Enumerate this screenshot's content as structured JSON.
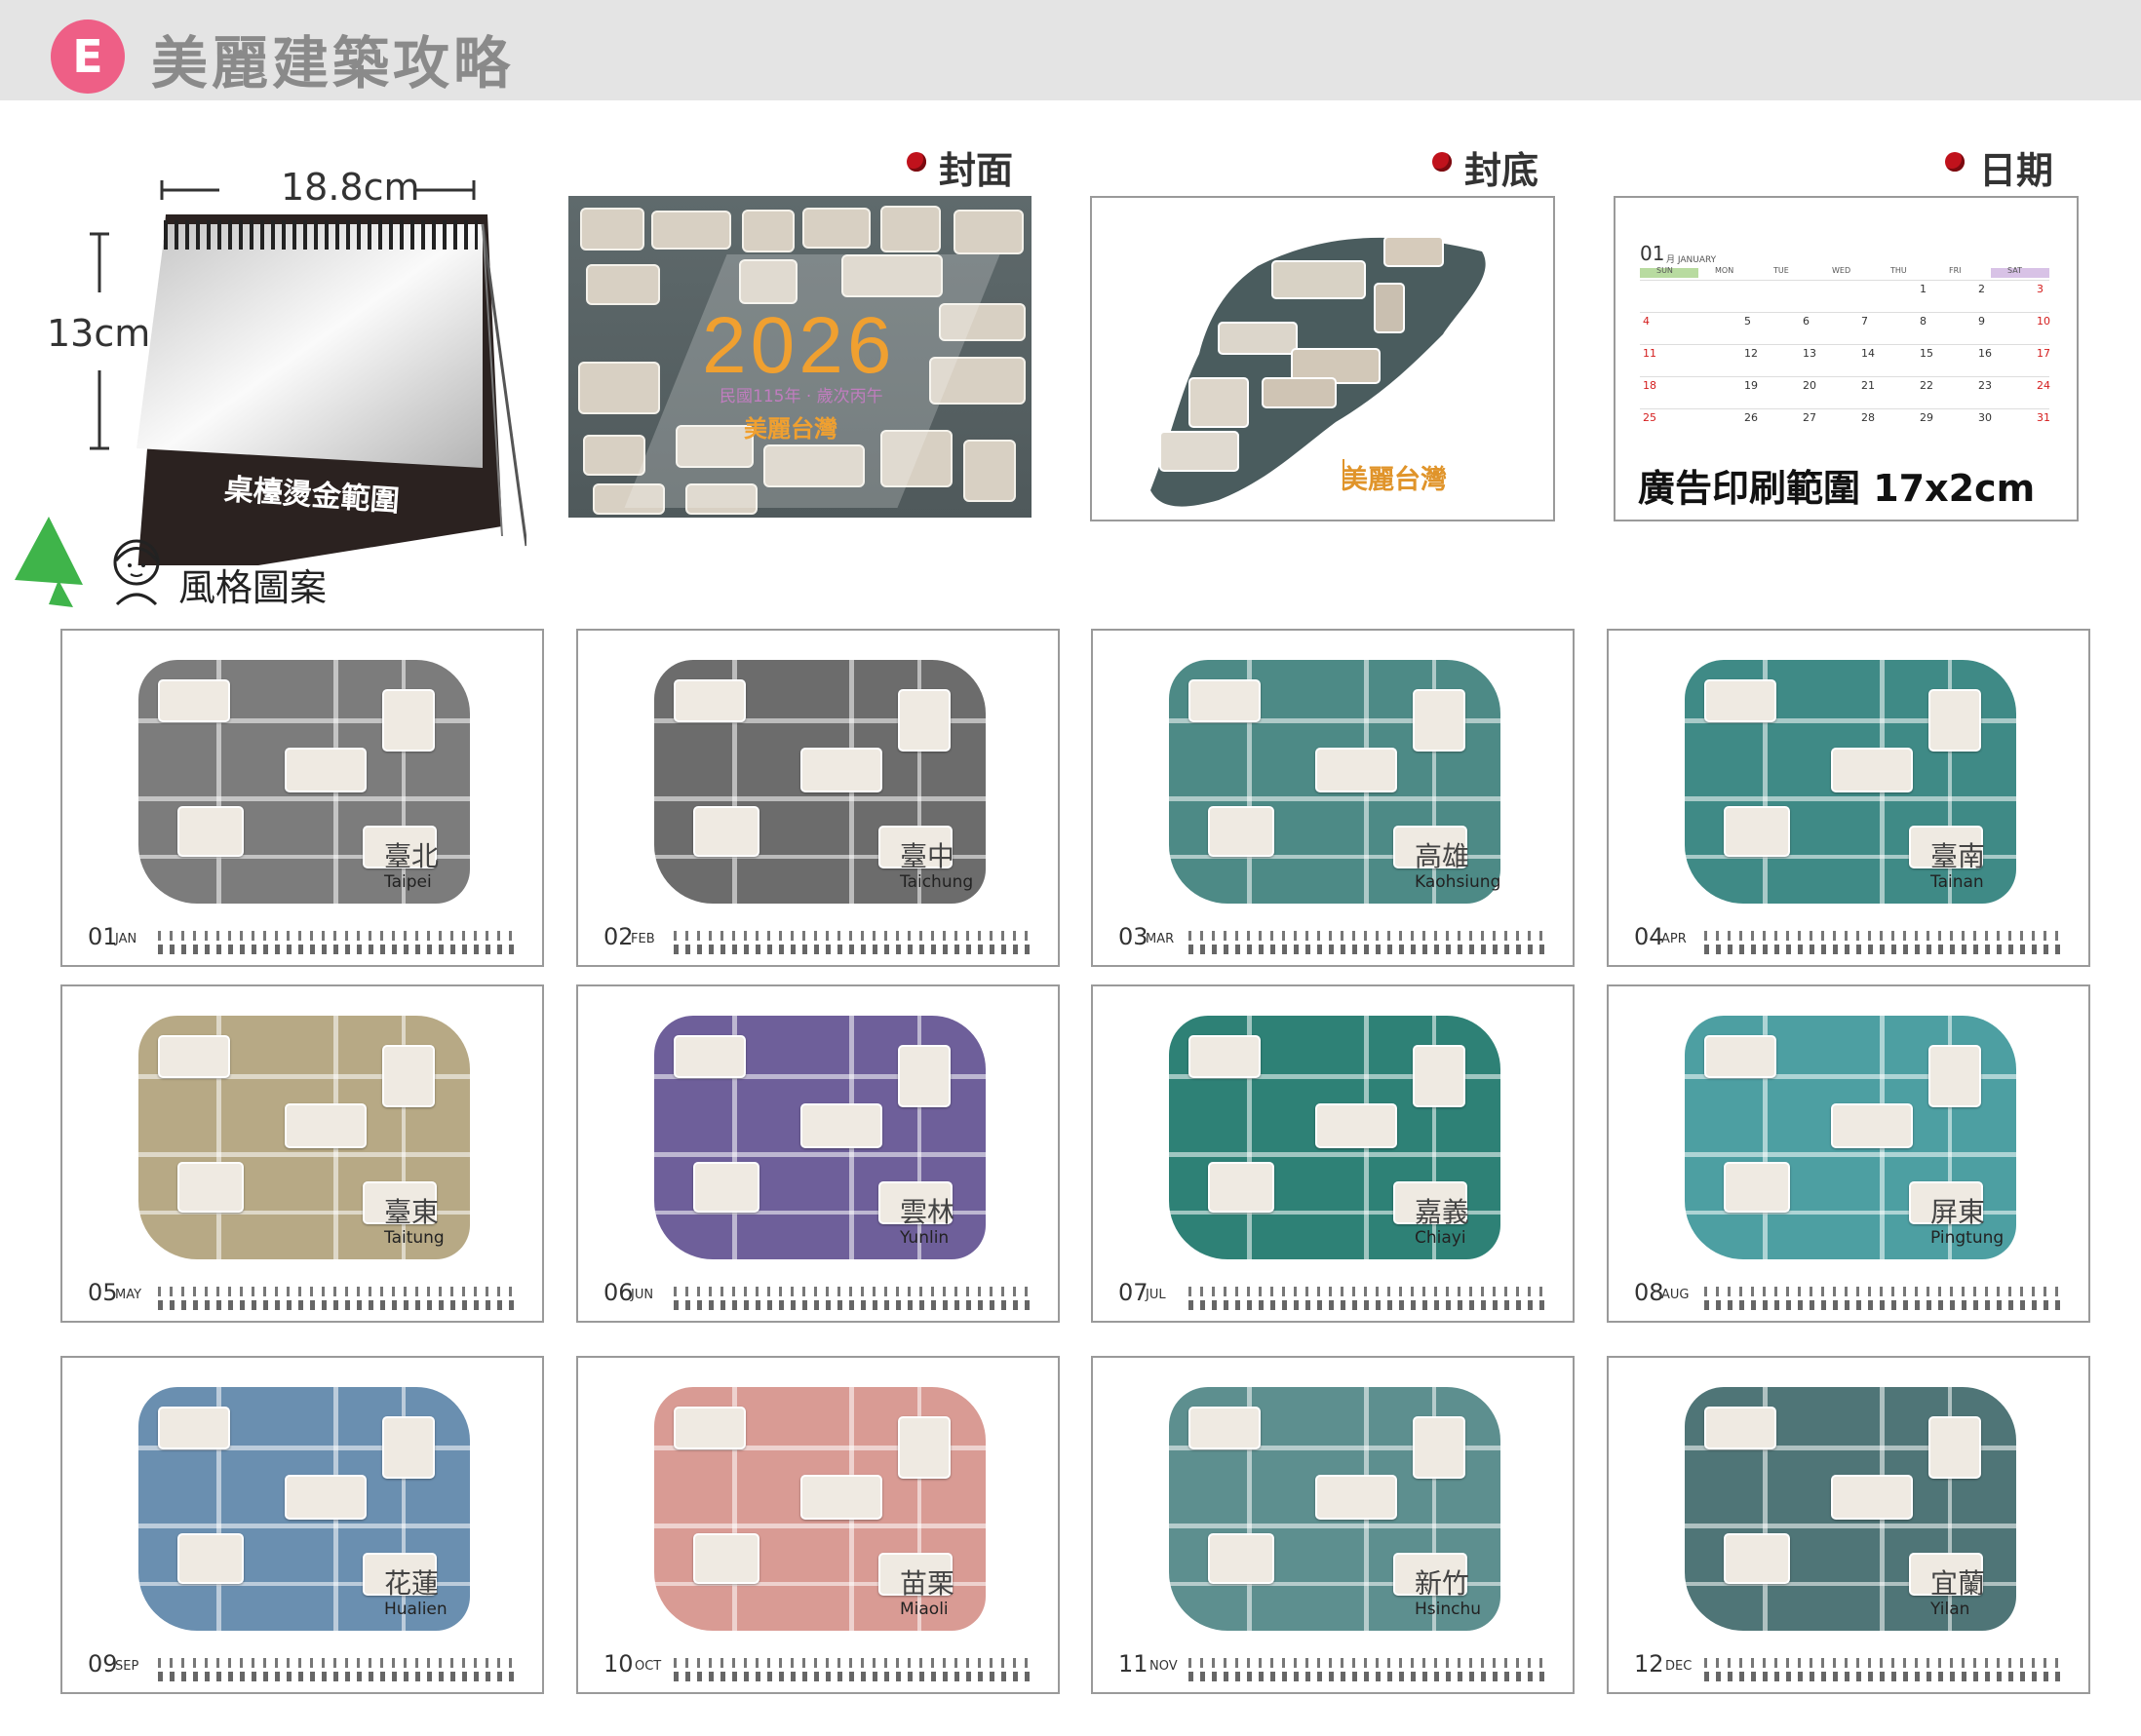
{
  "header": {
    "badge": "E",
    "title": "美麗建築攻略"
  },
  "size": {
    "width": "18.8cm",
    "height": "13cm",
    "stand_label": "桌檯燙金範圍"
  },
  "sections": {
    "cover": "封面",
    "back": "封底",
    "date": "日期"
  },
  "cover": {
    "year": "2026",
    "subtitle": "民國115年 · 歲次丙午",
    "brand": "美麗台灣"
  },
  "back": {
    "brand": "美麗台灣"
  },
  "date_panel": {
    "month_num": "01",
    "month_label": "月 JANUARY",
    "weekdays": [
      "SUN",
      "MON",
      "TUE",
      "WED",
      "THU",
      "FRI",
      "SAT"
    ],
    "weeks": [
      [
        "",
        "",
        "",
        "",
        "1",
        "2",
        "3"
      ],
      [
        "4",
        "5",
        "6",
        "7",
        "8",
        "9",
        "10"
      ],
      [
        "11",
        "12",
        "13",
        "14",
        "15",
        "16",
        "17"
      ],
      [
        "18",
        "19",
        "20",
        "21",
        "22",
        "23",
        "24"
      ],
      [
        "25",
        "26",
        "27",
        "28",
        "29",
        "30",
        "31"
      ]
    ],
    "ad_text": "廣告印刷範圍 17x2cm"
  },
  "style_label": "風格圖案",
  "months": [
    {
      "num": "01",
      "abbr": "JAN",
      "city_zh": "臺北",
      "city_en": "Taipei",
      "color": "#7c7c7c"
    },
    {
      "num": "02",
      "abbr": "FEB",
      "city_zh": "臺中",
      "city_en": "Taichung",
      "color": "#6c6c6c"
    },
    {
      "num": "03",
      "abbr": "MAR",
      "city_zh": "高雄",
      "city_en": "Kaohsiung",
      "color": "#4d8a86"
    },
    {
      "num": "04",
      "abbr": "APR",
      "city_zh": "臺南",
      "city_en": "Tainan",
      "color": "#3f8a86"
    },
    {
      "num": "05",
      "abbr": "MAY",
      "city_zh": "臺東",
      "city_en": "Taitung",
      "color": "#b7a985"
    },
    {
      "num": "06",
      "abbr": "JUN",
      "city_zh": "雲林",
      "city_en": "Yunlin",
      "color": "#6e5f9a"
    },
    {
      "num": "07",
      "abbr": "JUL",
      "city_zh": "嘉義",
      "city_en": "Chiayi",
      "color": "#2e8176"
    },
    {
      "num": "08",
      "abbr": "AUG",
      "city_zh": "屏東",
      "city_en": "Pingtung",
      "color": "#4d9fa2"
    },
    {
      "num": "09",
      "abbr": "SEP",
      "city_zh": "花蓮",
      "city_en": "Hualien",
      "color": "#6a8fb0"
    },
    {
      "num": "10",
      "abbr": "OCT",
      "city_zh": "苗栗",
      "city_en": "Miaoli",
      "color": "#d99b94"
    },
    {
      "num": "11",
      "abbr": "NOV",
      "city_zh": "新竹",
      "city_en": "Hsinchu",
      "color": "#5d8f8f"
    },
    {
      "num": "12",
      "abbr": "DEC",
      "city_zh": "宜蘭",
      "city_en": "Yilan",
      "color": "#4f7577"
    }
  ]
}
